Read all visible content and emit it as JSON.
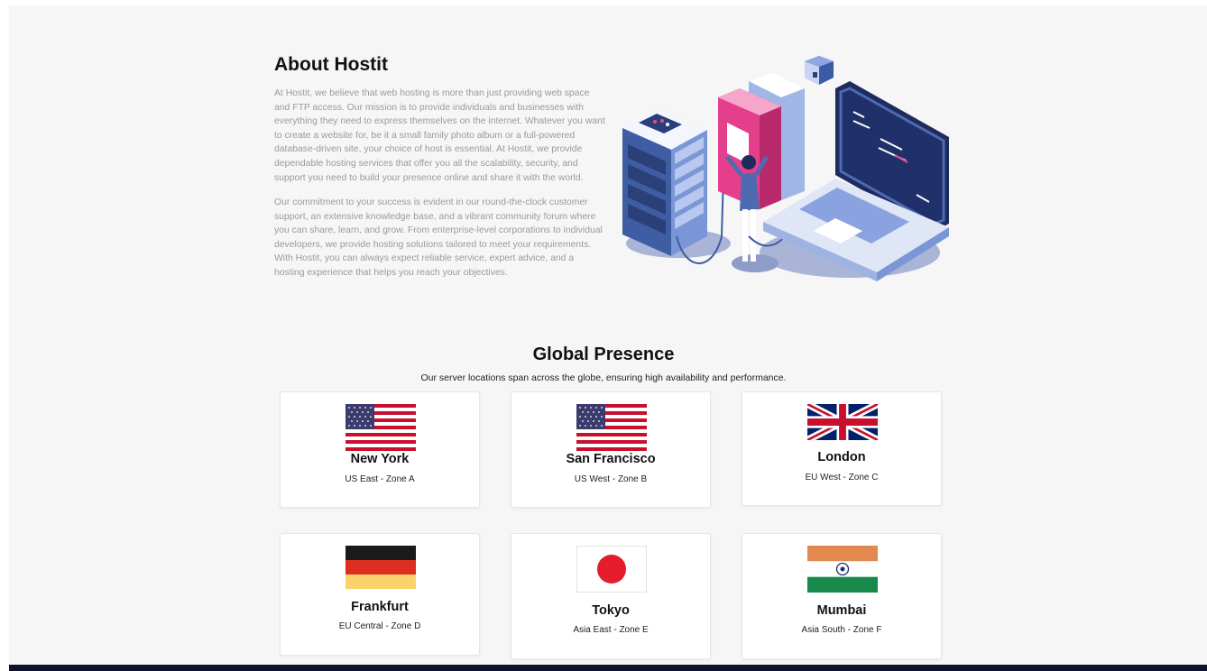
{
  "about": {
    "title": "About Hostit",
    "paragraph1": "At Hostit, we believe that web hosting is more than just providing web space and FTP access. Our mission is to provide individuals and businesses with everything they need to express themselves on the internet. Whatever you want to create a website for, be it a small family photo album or a full-powered database-driven site, your choice of host is essential. At Hostit, we provide dependable hosting services that offer you all the scalability, security, and support you need to build your presence online and share it with the world.",
    "paragraph2": "Our commitment to your success is evident in our round-the-clock customer support, an extensive knowledge base, and a vibrant community forum where you can share, learn, and grow. From enterprise-level corporations to individual developers, we provide hosting solutions tailored to meet your requirements. With Hostit, you can always expect reliable service, expert advice, and a hosting experience that helps you reach your objectives.",
    "illustration": "server-laptop-illustration"
  },
  "global": {
    "title": "Global Presence",
    "subtitle": "Our server locations span across the globe, ensuring high availability and performance.",
    "locations": [
      {
        "city": "New York",
        "zone": "US East - Zone A",
        "flag": "us-flag-icon"
      },
      {
        "city": "San Francisco",
        "zone": "US West - Zone B",
        "flag": "us-flag-icon"
      },
      {
        "city": "London",
        "zone": "EU West - Zone C",
        "flag": "uk-flag-icon"
      },
      {
        "city": "Frankfurt",
        "zone": "EU Central - Zone D",
        "flag": "germany-flag-icon"
      },
      {
        "city": "Tokyo",
        "zone": "Asia East - Zone E",
        "flag": "japan-flag-icon"
      },
      {
        "city": "Mumbai",
        "zone": "Asia South - Zone F",
        "flag": "india-flag-icon"
      }
    ]
  },
  "colors": {
    "page_bg": "#f6f6f6",
    "footer": "#0d1330",
    "muted_text": "#9a9a9a"
  }
}
